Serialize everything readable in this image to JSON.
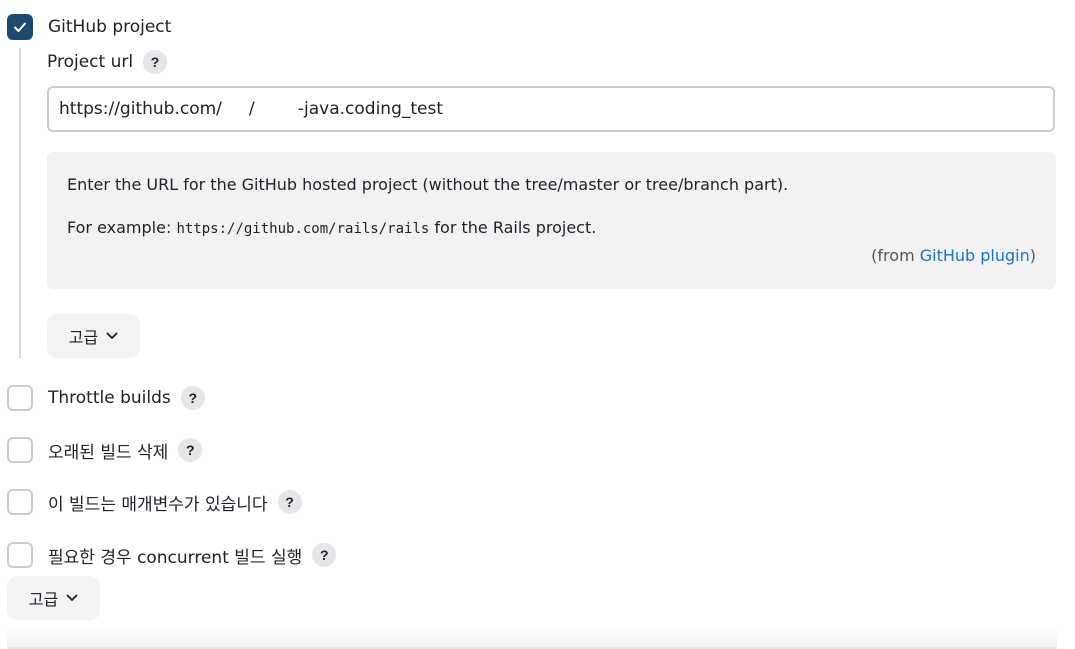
{
  "github_project": {
    "checkbox_label": "GitHub project",
    "checked": true,
    "project_url_label": "Project url",
    "project_url_value": "https://github.com/     /        -java.coding_test",
    "help": {
      "line1": "Enter the URL for the GitHub hosted project (without the tree/master or tree/branch part).",
      "line2_prefix": "For example: ",
      "line2_code": "https://github.com/rails/rails",
      "line2_suffix": " for the Rails project.",
      "from_prefix": "(from ",
      "from_link": "GitHub plugin",
      "from_suffix": ")"
    },
    "advanced_label": "고급"
  },
  "options": [
    {
      "label": "Throttle builds",
      "checked": false
    },
    {
      "label": "오래된 빌드 삭제",
      "checked": false
    },
    {
      "label": "이 빌드는 매개변수가 있습니다",
      "checked": false
    },
    {
      "label": "필요한 경우 concurrent 빌드 실행",
      "checked": false
    }
  ],
  "advanced_label": "고급",
  "help_glyph": "?",
  "colors": {
    "checkbox_checked": "#1e4a6e",
    "link": "#1a73c7"
  }
}
